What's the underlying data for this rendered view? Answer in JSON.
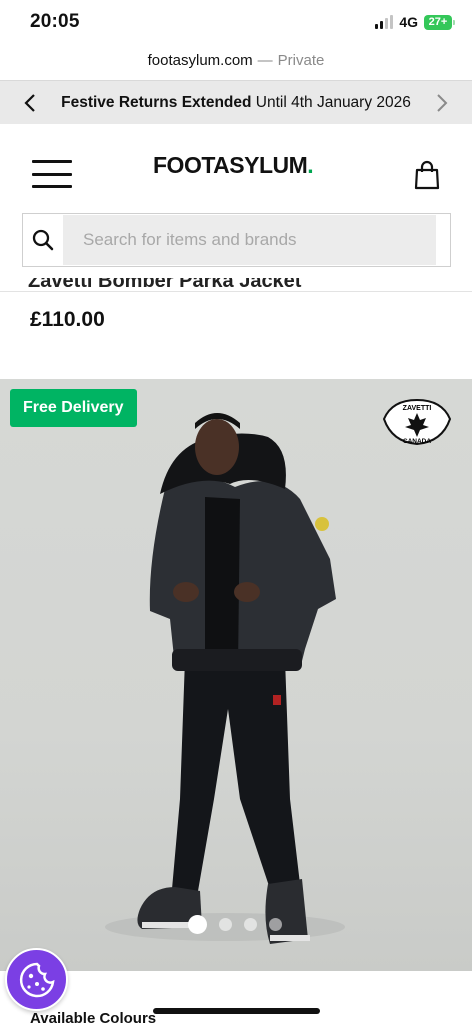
{
  "status_bar": {
    "time": "20:05",
    "network": "4G",
    "battery": "27+"
  },
  "browser": {
    "domain": "footasylum.com",
    "separator": "—",
    "mode": "Private"
  },
  "promo": {
    "title": "Festive Returns Extended",
    "subtitle": "Until 4th January 2026"
  },
  "header": {
    "logo_text": "FOOTASYLUM",
    "logo_dot": "."
  },
  "search": {
    "placeholder": "Search for items and brands",
    "value": ""
  },
  "product": {
    "name_partial": "Zavetti Bomber Parka Jacket",
    "price": "£110.00",
    "badge": "Free Delivery",
    "brand_badge_top": "ZAVETTI",
    "brand_badge_bottom": "CANADA",
    "carousel": {
      "total": 4,
      "active_index": 0
    }
  },
  "colours_label": "Available Colours",
  "colors": {
    "accent_green": "#00b463",
    "cookie_purple": "#7b3fe4",
    "promo_bg": "#e9e9e9"
  }
}
